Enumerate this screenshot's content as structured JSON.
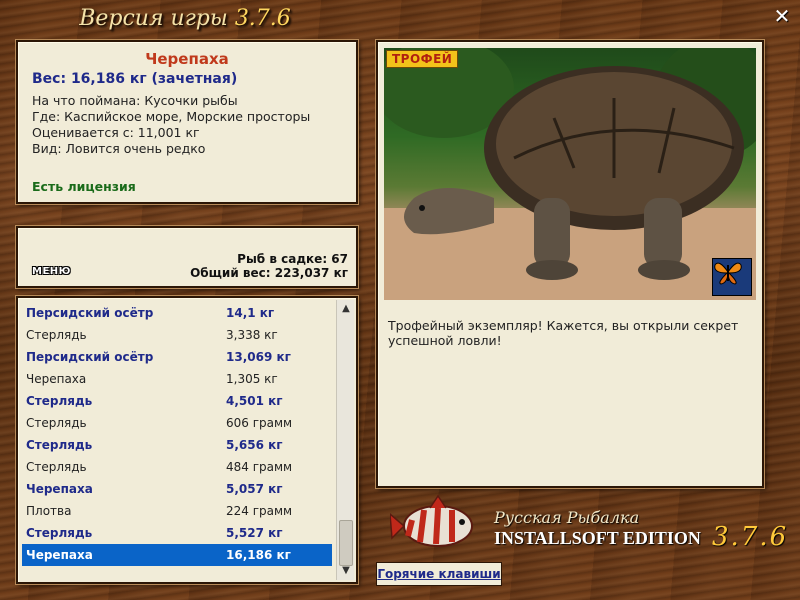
{
  "window": {
    "title_prefix": "Версия игры",
    "title_version": "3.7.6"
  },
  "info": {
    "fish_name": "Черепаха",
    "weight": "Вес: 16,186 кг (зачетная)",
    "caught_on": "На что поймана: Кусочки рыбы",
    "location": "Где: Каспийское море, Морские просторы",
    "valued_from": "Оценивается с: 11,001 кг",
    "rarity": "Вид: Ловится очень редко",
    "license": "Есть лицензия"
  },
  "stats": {
    "menu_label": "МЕНЮ",
    "fish_in_keepnet": "Рыб в садке: 67",
    "total_weight": "Общий вес: 223,037 кг"
  },
  "catch_list": [
    {
      "name": "Персидский осётр",
      "weight": "14,1 кг",
      "style": "bold"
    },
    {
      "name": "Стерлядь",
      "weight": "3,338 кг",
      "style": "normal"
    },
    {
      "name": "Персидский осётр",
      "weight": "13,069 кг",
      "style": "bold"
    },
    {
      "name": "Черепаха",
      "weight": "1,305 кг",
      "style": "normal"
    },
    {
      "name": "Стерлядь",
      "weight": "4,501 кг",
      "style": "bold"
    },
    {
      "name": "Стерлядь",
      "weight": "606 грамм",
      "style": "normal"
    },
    {
      "name": "Стерлядь",
      "weight": "5,656 кг",
      "style": "bold"
    },
    {
      "name": "Стерлядь",
      "weight": "484 грамм",
      "style": "normal"
    },
    {
      "name": "Черепаха",
      "weight": "5,057 кг",
      "style": "bold"
    },
    {
      "name": "Плотва",
      "weight": "224 грамм",
      "style": "normal"
    },
    {
      "name": "Стерлядь",
      "weight": "5,527 кг",
      "style": "bold"
    },
    {
      "name": "Черепаха",
      "weight": "16,186 кг",
      "style": "selected"
    }
  ],
  "photo": {
    "badge": "ТРОФЕЙ",
    "caption": "Трофейный экземпляр! Кажется, вы открыли секрет успешной ловли!",
    "icons": {
      "butterfly": "butterfly-icon"
    }
  },
  "logo": {
    "line1": "Русская Рыбалка",
    "line2": "INSTALLSOFT EDITION",
    "version": "3.7.6"
  },
  "hotkeys": {
    "label": "Горячие клавиши"
  },
  "colors": {
    "accent_red": "#c0391b",
    "accent_blue": "#1f2a8a",
    "license_green": "#1a6b1a",
    "selection": "#0a64c8"
  }
}
